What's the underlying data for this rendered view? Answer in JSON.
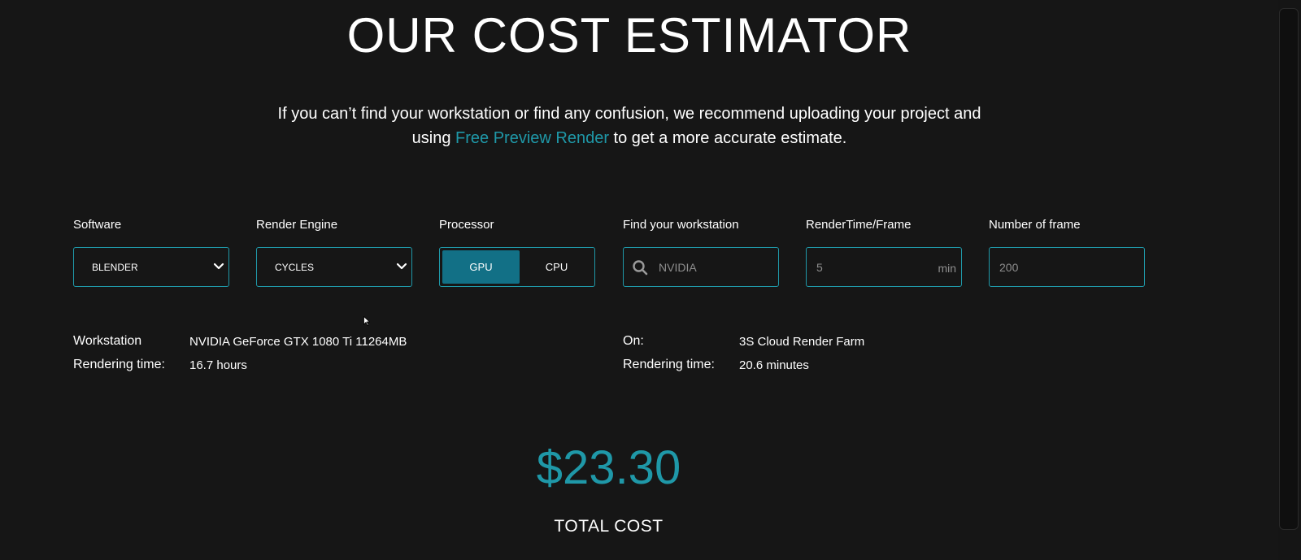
{
  "title": "OUR COST ESTIMATOR",
  "intro": {
    "line1": "If you can’t find your workstation or find any confusion, we recommend uploading your project and",
    "line2_before": "using ",
    "link_text": "Free Preview Render",
    "line2_after": " to get a more accurate estimate."
  },
  "form": {
    "software": {
      "label": "Software",
      "value": "BLENDER"
    },
    "render_engine": {
      "label": "Render Engine",
      "value": "CYCLES"
    },
    "processor": {
      "label": "Processor",
      "gpu": "GPU",
      "cpu": "CPU",
      "selected": "GPU"
    },
    "workstation": {
      "label": "Find your workstation",
      "value": "NVIDIA"
    },
    "render_time": {
      "label": "RenderTime/Frame",
      "value": "5",
      "unit": "min"
    },
    "frames": {
      "label": "Number of frame",
      "value": "200"
    }
  },
  "local": {
    "workstation_label": "Workstation",
    "workstation_value": "NVIDIA GeForce GTX 1080 Ti 11264MB",
    "time_label": "Rendering time:",
    "time_value": "16.7 hours"
  },
  "farm": {
    "on_label": "On:",
    "on_value": "3S Cloud Render Farm",
    "time_label": "Rendering time:",
    "time_value": "20.6 minutes"
  },
  "total": {
    "amount": "$23.30",
    "label": "TOTAL COST"
  },
  "colors": {
    "background": "#161616",
    "accent": "#1f98a8",
    "toggle_active": "#127086"
  }
}
